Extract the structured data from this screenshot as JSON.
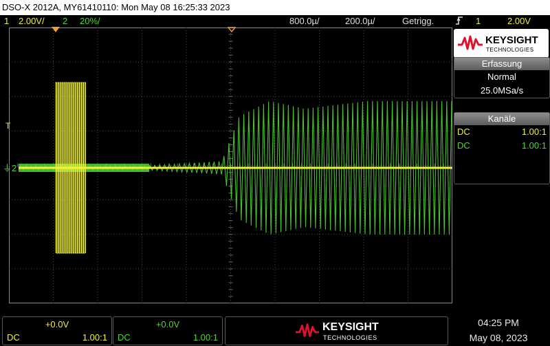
{
  "title_bar": "DSO-X 2012A, MY61410110: Mon May 08 16:25:33 2023",
  "status": {
    "ch1_num": "1",
    "ch1_scale": "2.00V/",
    "ch2_num": "2",
    "ch2_scale": "20%/",
    "timebase": "800.0µ/",
    "delay": "200.0µ/",
    "trigger_mode": "Getrigg.",
    "trigger_slope_icon": "rising-edge-icon",
    "trigger_source": "1",
    "trigger_level": "2.00V"
  },
  "brand": {
    "name": "KEYSIGHT",
    "sub": "TECHNOLOGIES"
  },
  "acquisition": {
    "header": "Erfassung",
    "mode": "Normal",
    "rate": "25.0MSa/s"
  },
  "channels": {
    "header": "Kanäle",
    "rows": [
      {
        "coupling": "DC",
        "probe": "1.00:1",
        "color": "#f2f23a"
      },
      {
        "coupling": "DC",
        "probe": "1.00:1",
        "color": "#52d633"
      }
    ]
  },
  "markers": {
    "trigger_level": "T",
    "ch2_ground": "2"
  },
  "bottom": {
    "ch1": {
      "offset": "+0.0V",
      "coupling": "DC",
      "probe": "1.00:1"
    },
    "ch2": {
      "offset": "+0.0V",
      "coupling": "DC",
      "probe": "1.00:1"
    },
    "time": "04:25 PM",
    "date": "May 08, 2023"
  },
  "colors": {
    "ch1": "#f2f23a",
    "ch2": "#52d633",
    "grid": "#4a4a4a",
    "brand_red": "#e0112b"
  }
}
